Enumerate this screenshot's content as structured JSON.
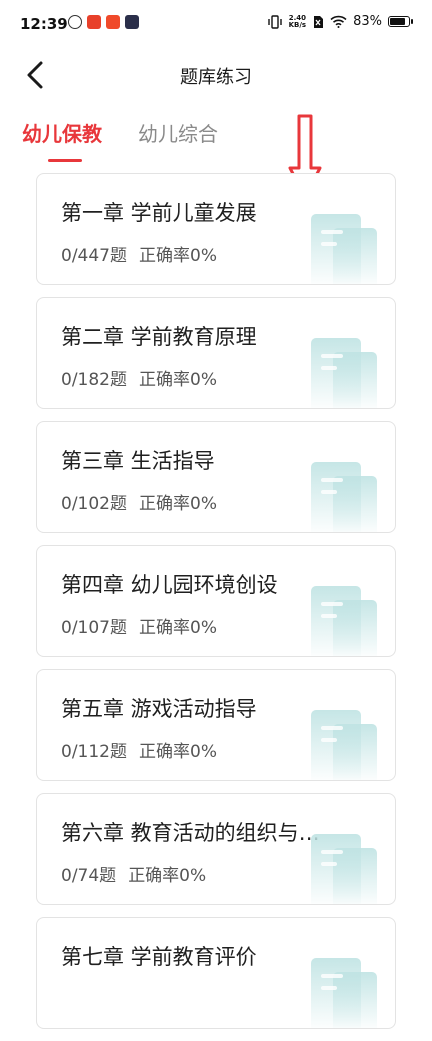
{
  "status_bar": {
    "time": "12:39",
    "net_speed_value": "2.40",
    "net_speed_unit": "KB/s",
    "battery": "83%",
    "battery_level": 0.83
  },
  "header": {
    "title": "题库练习",
    "back_icon": "chevron-left-icon"
  },
  "tabs": [
    {
      "label": "幼儿保教",
      "active": true
    },
    {
      "label": "幼儿综合",
      "active": false
    }
  ],
  "colors": {
    "accent": "#e8373b",
    "inactive_tab": "#8a8a8a",
    "deco": "#bfe3e3"
  },
  "chapters": [
    {
      "title": "第一章 学前儿童发展",
      "progress": "0/447题",
      "rate": "正确率0%"
    },
    {
      "title": "第二章 学前教育原理",
      "progress": "0/182题",
      "rate": "正确率0%"
    },
    {
      "title": "第三章 生活指导",
      "progress": "0/102题",
      "rate": "正确率0%"
    },
    {
      "title": "第四章 幼儿园环境创设",
      "progress": "0/107题",
      "rate": "正确率0%"
    },
    {
      "title": "第五章 游戏活动指导",
      "progress": "0/112题",
      "rate": "正确率0%"
    },
    {
      "title": "第六章 教育活动的组织与…",
      "progress": "0/74题",
      "rate": "正确率0%"
    },
    {
      "title": "第七章 学前教育评价",
      "progress": "",
      "rate": ""
    }
  ]
}
